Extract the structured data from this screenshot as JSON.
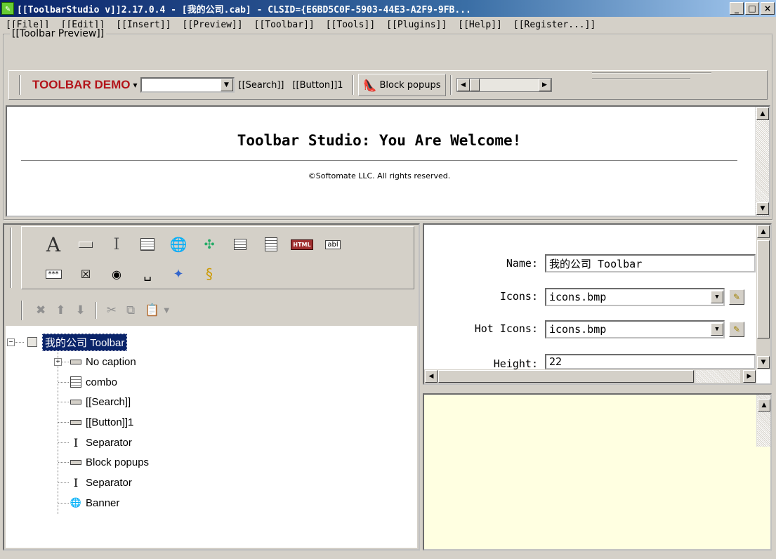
{
  "window": {
    "title": "[[ToolbarStudio v]]2.17.0.4 - [我的公司.cab] - CLSID={E6BD5C0F-5903-44E3-A2F9-9FB...",
    "minimize": "_",
    "maximize": "□",
    "close": "×"
  },
  "menu": [
    "[[File]]",
    "[[Edit]]",
    "[[Insert]]",
    "[[Preview]]",
    "[[Toolbar]]",
    "[[Tools]]",
    "[[Plugins]]",
    "[[Help]]",
    "[[Register...]]"
  ],
  "preview_group": {
    "label": "[[Toolbar Preview]]",
    "toolbar": {
      "brand": "TOOLBAR DEMO",
      "brand_arrow": "▾",
      "combo_value": "",
      "search_button": "[[Search]]",
      "button1": "[[Button]]1",
      "block_popups": "Block popups"
    },
    "welcome": "Toolbar Studio: You Are Welcome!",
    "copyright": "©Softomate LLC. All rights reserved."
  },
  "palette": {
    "row1": [
      "text-icon",
      "button-icon",
      "separator-icon",
      "combo-icon",
      "banner-icon",
      "xml-icon",
      "textbox-icon",
      "memo-icon",
      "html-icon",
      "label-icon"
    ],
    "row2": [
      "password-icon",
      "checkbox-icon",
      "radio-icon",
      "space-icon",
      "xml-button-icon",
      "script-icon"
    ],
    "text_glyph": "A",
    "html_label": "HTML",
    "label_text": "abl",
    "password_text": "***"
  },
  "tree": {
    "root": "我的公司 Toolbar",
    "items": [
      {
        "label": "No caption",
        "icon": "button-icon"
      },
      {
        "label": "combo",
        "icon": "combo-icon"
      },
      {
        "label": "[[Search]]",
        "icon": "button-icon"
      },
      {
        "label": "[[Button]]1",
        "icon": "button-icon"
      },
      {
        "label": "Separator",
        "icon": "separator-icon"
      },
      {
        "label": "Block popups",
        "icon": "button-icon"
      },
      {
        "label": "Separator",
        "icon": "separator-icon"
      },
      {
        "label": "Banner",
        "icon": "banner-icon"
      }
    ]
  },
  "properties": [
    {
      "label": "Name:",
      "value": "我的公司 Toolbar"
    },
    {
      "label": "Icons:",
      "value": "icons.bmp"
    },
    {
      "label": "Hot Icons:",
      "value": "icons.bmp"
    },
    {
      "label": "Height:",
      "value": "22"
    }
  ],
  "colors": {
    "brand": "#b3141a",
    "selection": "#0a246a",
    "description_bg": "#ffffe1"
  }
}
